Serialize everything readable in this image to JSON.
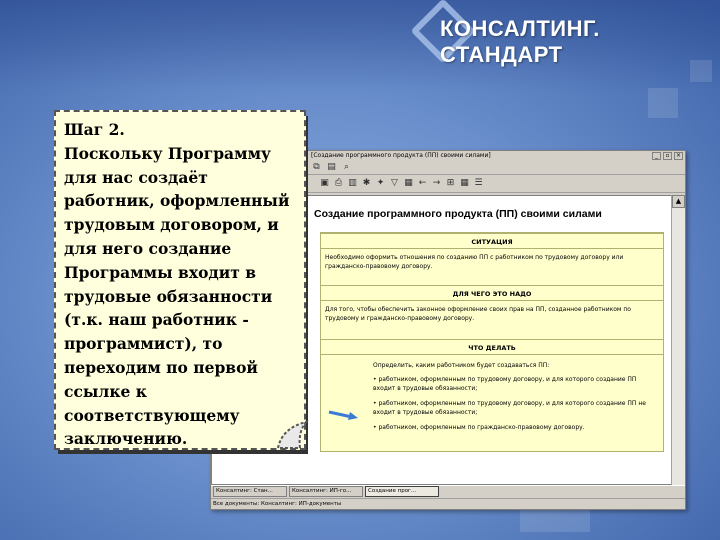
{
  "slide": {
    "brand": "КОНСАЛТИНГ. СТАНДАРТ",
    "accent_color": "#3d62a8",
    "note": {
      "step": "Шаг 2.",
      "text": "Поскольку Программу для нас создаёт работник, оформленный трудовым договором, и для него создание Программы входит в трудовые обязанности (т.к. наш работник - программист), то переходим по первой ссылке к соответствующему заключению.",
      "color": "#ffffdd"
    }
  },
  "screenshot": {
    "window_title": "[Создание программного продукта (ПП) своими силами]",
    "doc_title": "Создание программного продукта (ПП) своими силами",
    "sections": {
      "situation_header": "СИТУАЦИЯ",
      "situation_text": "Необходимо оформить отношения по созданию ПП с работником по трудовому договору или гражданско-правовому договору.",
      "purpose_header": "ДЛЯ ЧЕГО ЭТО НАДО",
      "purpose_text": "Для того, чтобы обеспечить законное оформление своих прав на ПП, созданное работником по трудовому и гражданско-правовому договору.",
      "todo_header": "ЧТО ДЕЛАТЬ",
      "todo_intro": "Определить, каким работником будет создаваться ПП:",
      "todo_items": [
        "работником, оформленным по трудовому договору, и для которого создание ПП входит в трудовые обязанности;",
        "работником, оформленным по трудовому договору, и для которого создание ПП не входит в трудовые обязанности;",
        "работником, оформленным по гражданско-правовому договору."
      ]
    },
    "taskbar": [
      "Консалтинг: Стан...",
      "Консалтинг: ИП-го...",
      "Создание прог..."
    ],
    "status": "Все документы: Консалтинг: ИП-документы"
  }
}
